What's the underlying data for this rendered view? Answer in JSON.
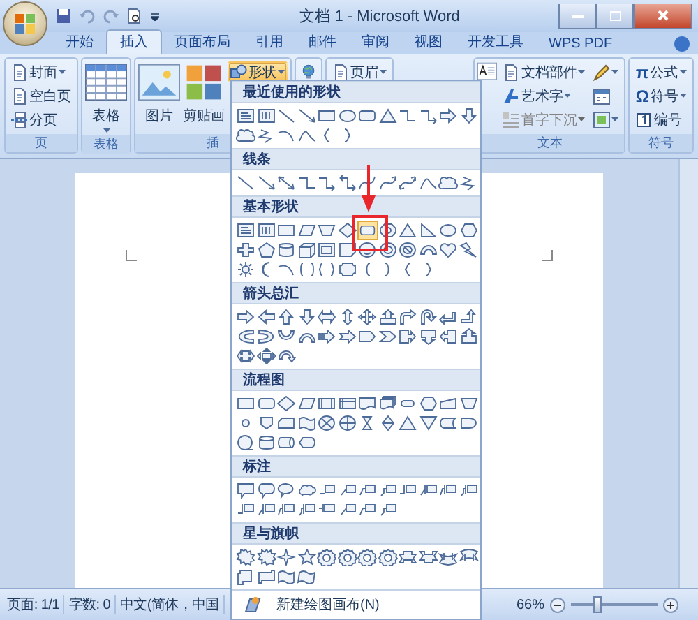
{
  "window": {
    "title": "文档 1 - Microsoft Word"
  },
  "tabs": [
    {
      "label": "开始",
      "selected": false
    },
    {
      "label": "插入",
      "selected": true
    },
    {
      "label": "页面布局",
      "selected": false
    },
    {
      "label": "引用",
      "selected": false
    },
    {
      "label": "邮件",
      "selected": false
    },
    {
      "label": "审阅",
      "selected": false
    },
    {
      "label": "视图",
      "selected": false
    },
    {
      "label": "开发工具",
      "selected": false
    },
    {
      "label": "WPS PDF",
      "selected": false
    }
  ],
  "ribbon": {
    "groups": [
      {
        "label": "页",
        "items": [
          {
            "kind": "small",
            "label": "封面",
            "dropdown": true,
            "selected": false,
            "disabled": false
          },
          {
            "kind": "small",
            "label": "空白页",
            "dropdown": false,
            "selected": false,
            "disabled": false
          },
          {
            "kind": "small",
            "label": "分页",
            "dropdown": false,
            "selected": false,
            "disabled": false
          }
        ]
      },
      {
        "label": "表格",
        "items": [
          {
            "kind": "large",
            "label": "表格",
            "dropdown": true,
            "selected": false,
            "disabled": false
          }
        ]
      },
      {
        "label": "插",
        "items": [
          {
            "kind": "large",
            "label": "图片",
            "dropdown": false,
            "selected": false,
            "disabled": false
          },
          {
            "kind": "large",
            "label": "剪贴画",
            "dropdown": false,
            "selected": false,
            "disabled": false
          },
          {
            "kind": "small",
            "label": "形状",
            "dropdown": true,
            "selected": true,
            "disabled": false
          }
        ]
      },
      {
        "items": [
          {
            "kind": "large",
            "dropdown": false,
            "selected": false,
            "disabled": false
          }
        ]
      },
      {
        "items": [
          {
            "kind": "small",
            "label": "页眉",
            "dropdown": true,
            "selected": false,
            "disabled": false
          }
        ]
      },
      {
        "label": "文本",
        "items": [
          {
            "kind": "large",
            "dropdown": false,
            "selected": false,
            "disabled": false
          },
          {
            "kind": "small",
            "label": "文档部件",
            "dropdown": true,
            "selected": false,
            "disabled": false
          },
          {
            "kind": "small",
            "label": "艺术字",
            "dropdown": true,
            "selected": false,
            "disabled": false
          },
          {
            "kind": "small",
            "label": "首字下沉",
            "dropdown": true,
            "selected": false,
            "disabled": true
          },
          {
            "kind": "icon",
            "dropdown": true,
            "selected": false,
            "disabled": false
          },
          {
            "kind": "icon",
            "dropdown": false,
            "selected": false,
            "disabled": false
          },
          {
            "kind": "icon",
            "dropdown": true,
            "selected": false,
            "disabled": false
          }
        ]
      },
      {
        "label": "符号",
        "items": [
          {
            "kind": "small",
            "glyph": "π",
            "label": "公式",
            "dropdown": true,
            "selected": false,
            "disabled": false
          },
          {
            "kind": "small",
            "glyph": "Ω",
            "label": "符号",
            "dropdown": true,
            "selected": false,
            "disabled": false
          },
          {
            "kind": "small",
            "label": "编号",
            "dropdown": false,
            "selected": false,
            "disabled": false
          }
        ]
      }
    ]
  },
  "shapes_menu": {
    "sections": [
      {
        "title": "最近使用的形状",
        "shapes": [
          {
            "kind": "textbox",
            "selected": false
          },
          {
            "kind": "vtextbox",
            "selected": false
          },
          {
            "kind": "line",
            "selected": false
          },
          {
            "kind": "arrowline",
            "selected": false
          },
          {
            "kind": "rect",
            "selected": false
          },
          {
            "kind": "oval",
            "selected": false
          },
          {
            "kind": "roundrect",
            "selected": false
          },
          {
            "kind": "triangle",
            "selected": false
          },
          {
            "kind": "elbow",
            "selected": false
          },
          {
            "kind": "elbowarrow",
            "selected": false
          },
          {
            "kind": "rarrow",
            "selected": false
          },
          {
            "kind": "darrow",
            "selected": false
          },
          {
            "kind": "cloud",
            "selected": false
          },
          {
            "kind": "scribble",
            "selected": false
          },
          {
            "kind": "arc",
            "selected": false
          },
          {
            "kind": "wave",
            "selected": false
          },
          {
            "kind": "brace-l",
            "selected": false
          },
          {
            "kind": "brace-r",
            "selected": false
          }
        ]
      },
      {
        "title": "线条",
        "shapes": [
          {
            "kind": "line",
            "selected": false
          },
          {
            "kind": "arrowline",
            "selected": false
          },
          {
            "kind": "dblarrow",
            "selected": false
          },
          {
            "kind": "elbow",
            "selected": false
          },
          {
            "kind": "elbowarrow",
            "selected": false
          },
          {
            "kind": "elbowdbl",
            "selected": false
          },
          {
            "kind": "curve",
            "selected": false
          },
          {
            "kind": "curvearrow",
            "selected": false
          },
          {
            "kind": "curvedbl",
            "selected": false
          },
          {
            "kind": "wave",
            "selected": false
          },
          {
            "kind": "cloud",
            "selected": false
          },
          {
            "kind": "scribble",
            "selected": false
          }
        ]
      },
      {
        "title": "基本形状",
        "shapes": [
          {
            "kind": "textbox",
            "selected": false
          },
          {
            "kind": "vtextbox",
            "selected": false
          },
          {
            "kind": "rect",
            "selected": false
          },
          {
            "kind": "parallelogram",
            "selected": false
          },
          {
            "kind": "trapezoid",
            "selected": false
          },
          {
            "kind": "diamond",
            "selected": false
          },
          {
            "kind": "roundrect",
            "selected": true
          },
          {
            "kind": "octagon",
            "selected": false
          },
          {
            "kind": "triangle",
            "selected": false
          },
          {
            "kind": "rtriangle",
            "selected": false
          },
          {
            "kind": "oval",
            "selected": false
          },
          {
            "kind": "hexagon",
            "selected": false
          },
          {
            "kind": "cross",
            "selected": false
          },
          {
            "kind": "pentagon",
            "selected": false
          },
          {
            "kind": "can",
            "selected": false
          },
          {
            "kind": "cube",
            "selected": false
          },
          {
            "kind": "frame",
            "selected": false
          },
          {
            "kind": "folded",
            "selected": false
          },
          {
            "kind": "smiley",
            "selected": false
          },
          {
            "kind": "donut",
            "selected": false
          },
          {
            "kind": "nosymbol",
            "selected": false
          },
          {
            "kind": "blockarc",
            "selected": false
          },
          {
            "kind": "heart",
            "selected": false
          },
          {
            "kind": "bolt",
            "selected": false
          },
          {
            "kind": "sun",
            "selected": false
          },
          {
            "kind": "moon",
            "selected": false
          },
          {
            "kind": "arc",
            "selected": false
          },
          {
            "kind": "bracketpair",
            "selected": false
          },
          {
            "kind": "bracepair",
            "selected": false
          },
          {
            "kind": "plaque",
            "selected": false
          },
          {
            "kind": "bracket-l",
            "selected": false
          },
          {
            "kind": "bracket-r",
            "selected": false
          },
          {
            "kind": "brace-l",
            "selected": false
          },
          {
            "kind": "brace-r",
            "selected": false
          }
        ]
      },
      {
        "title": "箭头总汇",
        "shapes": [
          {
            "kind": "rarrow",
            "selected": false
          },
          {
            "kind": "larrow",
            "selected": false
          },
          {
            "kind": "uarrow",
            "selected": false
          },
          {
            "kind": "darrow",
            "selected": false
          },
          {
            "kind": "lrarrow",
            "selected": false
          },
          {
            "kind": "udarrow",
            "selected": false
          },
          {
            "kind": "quadarrow",
            "selected": false
          },
          {
            "kind": "uparrowcallout",
            "selected": false
          },
          {
            "kind": "bentarrow",
            "selected": false
          },
          {
            "kind": "uturn",
            "selected": false
          },
          {
            "kind": "lturn",
            "selected": false
          },
          {
            "kind": "bentup",
            "selected": false
          },
          {
            "kind": "curved-l",
            "selected": false
          },
          {
            "kind": "curved-r",
            "selected": false
          },
          {
            "kind": "curved-u",
            "selected": false
          },
          {
            "kind": "curved-d",
            "selected": false
          },
          {
            "kind": "striped",
            "selected": false
          },
          {
            "kind": "notched",
            "selected": false
          },
          {
            "kind": "pentarrow",
            "selected": false
          },
          {
            "kind": "chevron",
            "selected": false
          },
          {
            "kind": "callout-r",
            "selected": false
          },
          {
            "kind": "callout-d",
            "selected": false
          },
          {
            "kind": "callout-l",
            "selected": false
          },
          {
            "kind": "callout-u",
            "selected": false
          },
          {
            "kind": "callout-lr",
            "selected": false
          },
          {
            "kind": "callout-quad",
            "selected": false
          },
          {
            "kind": "circular",
            "selected": false
          }
        ]
      },
      {
        "title": "流程图",
        "shapes": [
          {
            "kind": "rect",
            "selected": false
          },
          {
            "kind": "roundrect",
            "selected": false
          },
          {
            "kind": "diamond",
            "selected": false
          },
          {
            "kind": "parallelogram",
            "selected": false
          },
          {
            "kind": "flow-predef",
            "selected": false
          },
          {
            "kind": "flow-internal",
            "selected": false
          },
          {
            "kind": "flow-doc",
            "selected": false
          },
          {
            "kind": "flow-multidoc",
            "selected": false
          },
          {
            "kind": "flow-terminator",
            "selected": false
          },
          {
            "kind": "hexagon",
            "selected": false
          },
          {
            "kind": "flow-manual",
            "selected": false
          },
          {
            "kind": "flow-manualop",
            "selected": false
          },
          {
            "kind": "flow-connector",
            "selected": false
          },
          {
            "kind": "flow-offpage",
            "selected": false
          },
          {
            "kind": "flow-card",
            "selected": false
          },
          {
            "kind": "flow-tape",
            "selected": false
          },
          {
            "kind": "flow-sumjunction",
            "selected": false
          },
          {
            "kind": "flow-or",
            "selected": false
          },
          {
            "kind": "flow-collate",
            "selected": false
          },
          {
            "kind": "flow-sort",
            "selected": false
          },
          {
            "kind": "triangle",
            "selected": false
          },
          {
            "kind": "flow-merge",
            "selected": false
          },
          {
            "kind": "flow-stored",
            "selected": false
          },
          {
            "kind": "flow-delay",
            "selected": false
          },
          {
            "kind": "flow-seq",
            "selected": false
          },
          {
            "kind": "can",
            "selected": false
          },
          {
            "kind": "flow-drum",
            "selected": false
          },
          {
            "kind": "flow-display",
            "selected": false
          }
        ]
      },
      {
        "title": "标注",
        "shapes": [
          {
            "kind": "callout-rect",
            "selected": false
          },
          {
            "kind": "callout-round",
            "selected": false
          },
          {
            "kind": "callout-oval",
            "selected": false
          },
          {
            "kind": "callout-cloud",
            "selected": false
          },
          {
            "kind": "callout-line",
            "selected": false
          },
          {
            "kind": "callout-line2",
            "selected": false
          },
          {
            "kind": "callout-line3",
            "selected": false
          },
          {
            "kind": "callout-line4",
            "selected": false
          },
          {
            "kind": "callout-dash",
            "selected": false
          },
          {
            "kind": "callout-dash2",
            "selected": false
          },
          {
            "kind": "callout-dash3",
            "selected": false
          },
          {
            "kind": "callout-dash4",
            "selected": false
          },
          {
            "kind": "callout-dash",
            "selected": false
          },
          {
            "kind": "callout-dash2",
            "selected": false
          },
          {
            "kind": "callout-dash3",
            "selected": false
          },
          {
            "kind": "callout-dash4",
            "selected": false
          },
          {
            "kind": "callout-bar",
            "selected": false
          },
          {
            "kind": "callout-line2",
            "selected": false
          },
          {
            "kind": "callout-line3",
            "selected": false
          },
          {
            "kind": "callout-line4",
            "selected": false
          }
        ]
      },
      {
        "title": "星与旗帜",
        "shapes": [
          {
            "kind": "burst",
            "selected": false
          },
          {
            "kind": "burst2",
            "selected": false
          },
          {
            "kind": "star4",
            "selected": false
          },
          {
            "kind": "star5",
            "selected": false
          },
          {
            "kind": "seal",
            "selected": false
          },
          {
            "kind": "seal",
            "selected": false
          },
          {
            "kind": "seal",
            "selected": false
          },
          {
            "kind": "seal",
            "selected": false
          },
          {
            "kind": "ribbon",
            "selected": false
          },
          {
            "kind": "ribbon-up",
            "selected": false
          },
          {
            "kind": "curved-ribbon",
            "selected": false
          },
          {
            "kind": "curved-ribbon-up",
            "selected": false
          },
          {
            "kind": "scroll-v",
            "selected": false
          },
          {
            "kind": "scroll-h",
            "selected": false
          },
          {
            "kind": "flow-tape",
            "selected": false
          },
          {
            "kind": "doublewave",
            "selected": false
          }
        ]
      }
    ],
    "footer": {
      "label": "新建绘图画布(N)"
    }
  },
  "status_bar": {
    "items": [
      "页面: 1/1",
      "字数: 0",
      "中文(简体，中国"
    ],
    "zoom": "66%",
    "zoom_level": {
      "level": 0.3
    }
  }
}
